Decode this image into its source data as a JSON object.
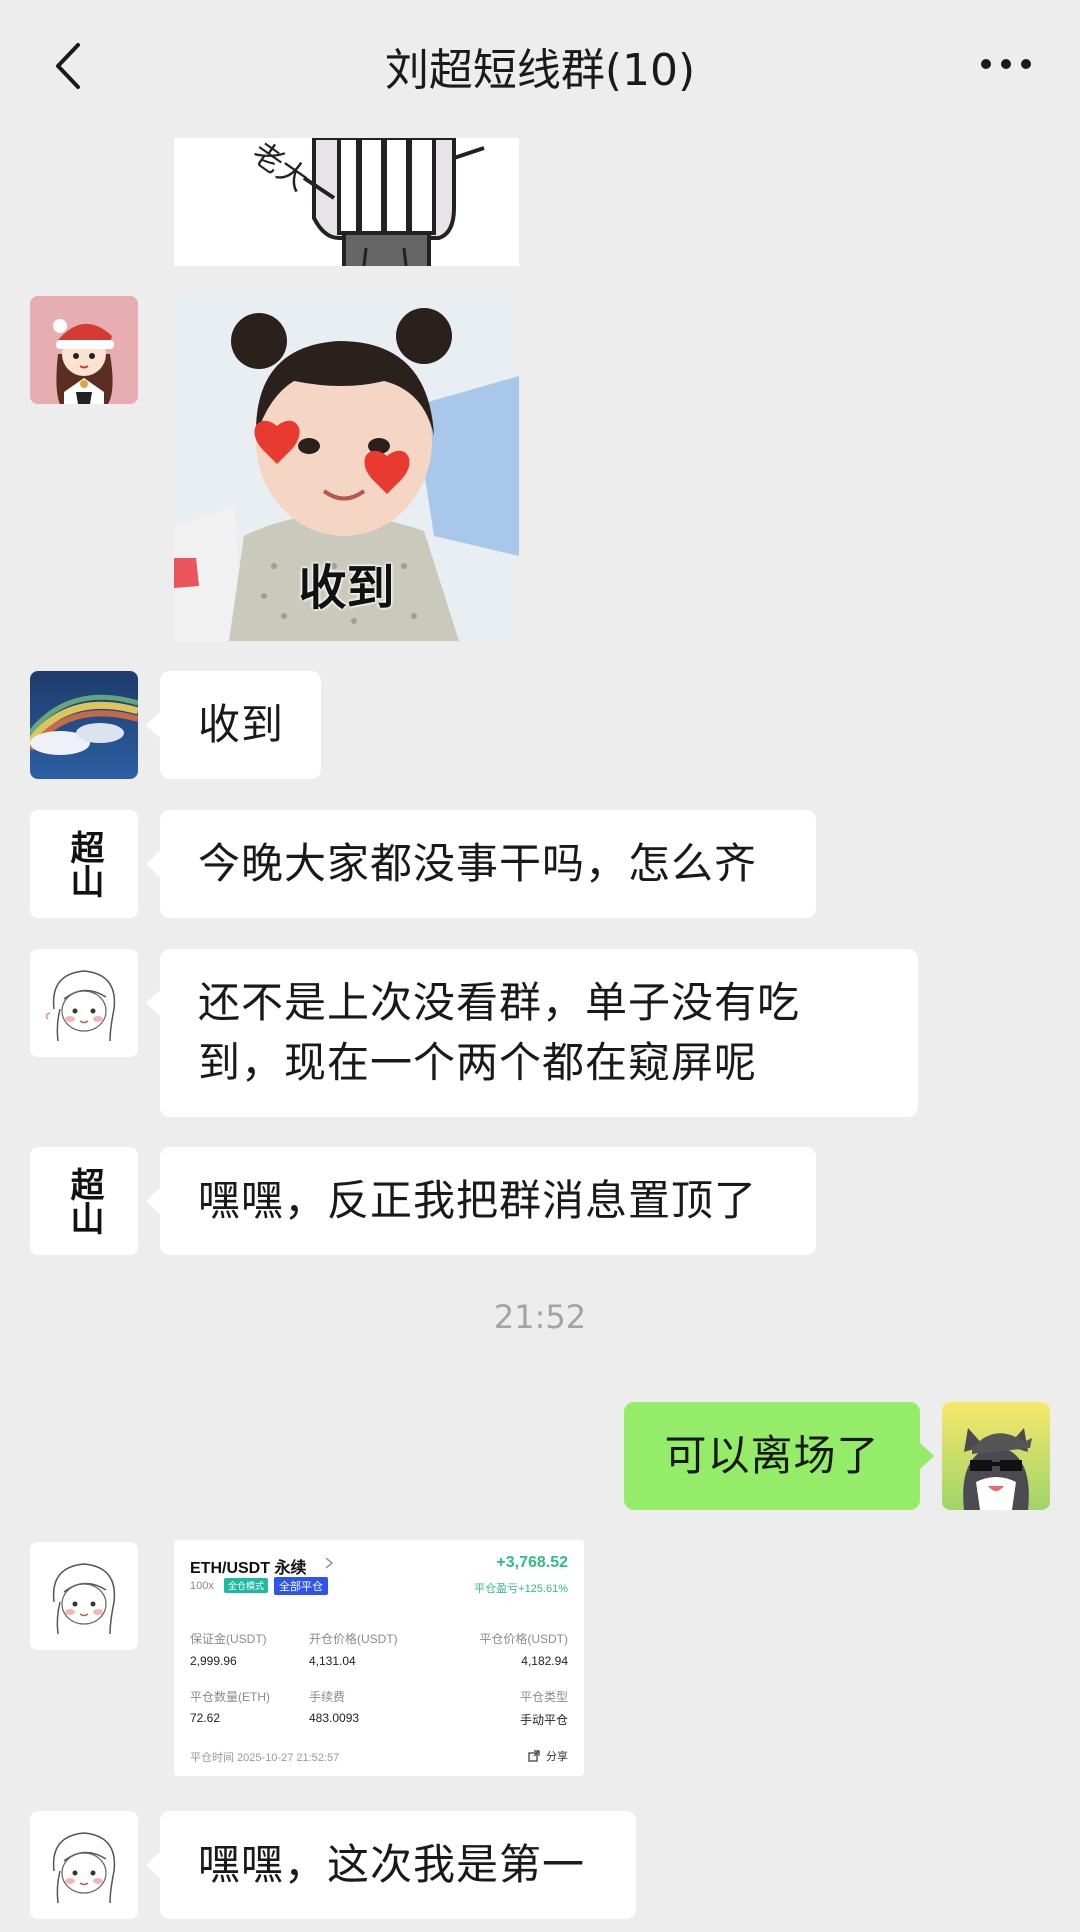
{
  "header": {
    "title": "刘超短线群(10)",
    "back_icon": "chevron-left-icon",
    "more_icon": "more-dots-icon"
  },
  "stickers": {
    "cartoon_partial_text": "老大",
    "girl_caption": "收到"
  },
  "messages": [
    {
      "sender": "avatar-rainbow",
      "text": "收到"
    },
    {
      "sender": "avatar-calligraphy",
      "text": "今晚大家都没事干吗，怎么齐"
    },
    {
      "sender": "avatar-sketch-girl",
      "line1": "还不是上次没看群，单子没有吃",
      "line2": "到，现在一个两个都在窥屏呢"
    },
    {
      "sender": "avatar-calligraphy",
      "text": "嘿嘿，反正我把群消息置顶了"
    },
    {
      "sender": "self",
      "text": "可以离场了"
    },
    {
      "sender": "avatar-sketch-girl",
      "text": "嘿嘿，这次我是第一"
    }
  ],
  "avatar_calligraphy_text": "超山",
  "timestamp": "21:52",
  "trade_card": {
    "pair": "ETH/USDT 永续",
    "leverage": "100x",
    "tag1": "全仓模式",
    "tag2": "全部平仓",
    "pnl": "+3,768.52",
    "pnl_label": "平仓盈亏+125.61%",
    "margin_label": "保证金(USDT)",
    "margin": "2,999.96",
    "open_label": "开仓价格(USDT)",
    "open": "4,131.04",
    "close_label": "平仓价格(USDT)",
    "close": "4,182.94",
    "qty_label": "平仓数量(ETH)",
    "qty": "72.62",
    "fee_label": "手续费",
    "fee": "483.0093",
    "type_label": "平仓类型",
    "type": "手动平仓",
    "time": "平仓时间  2025-10-27 21:52:57",
    "share": "分享",
    "colors": {
      "green": "#2ebd85",
      "tag_green": "#1fb8a3",
      "tag_blue": "#2f54eb"
    }
  }
}
